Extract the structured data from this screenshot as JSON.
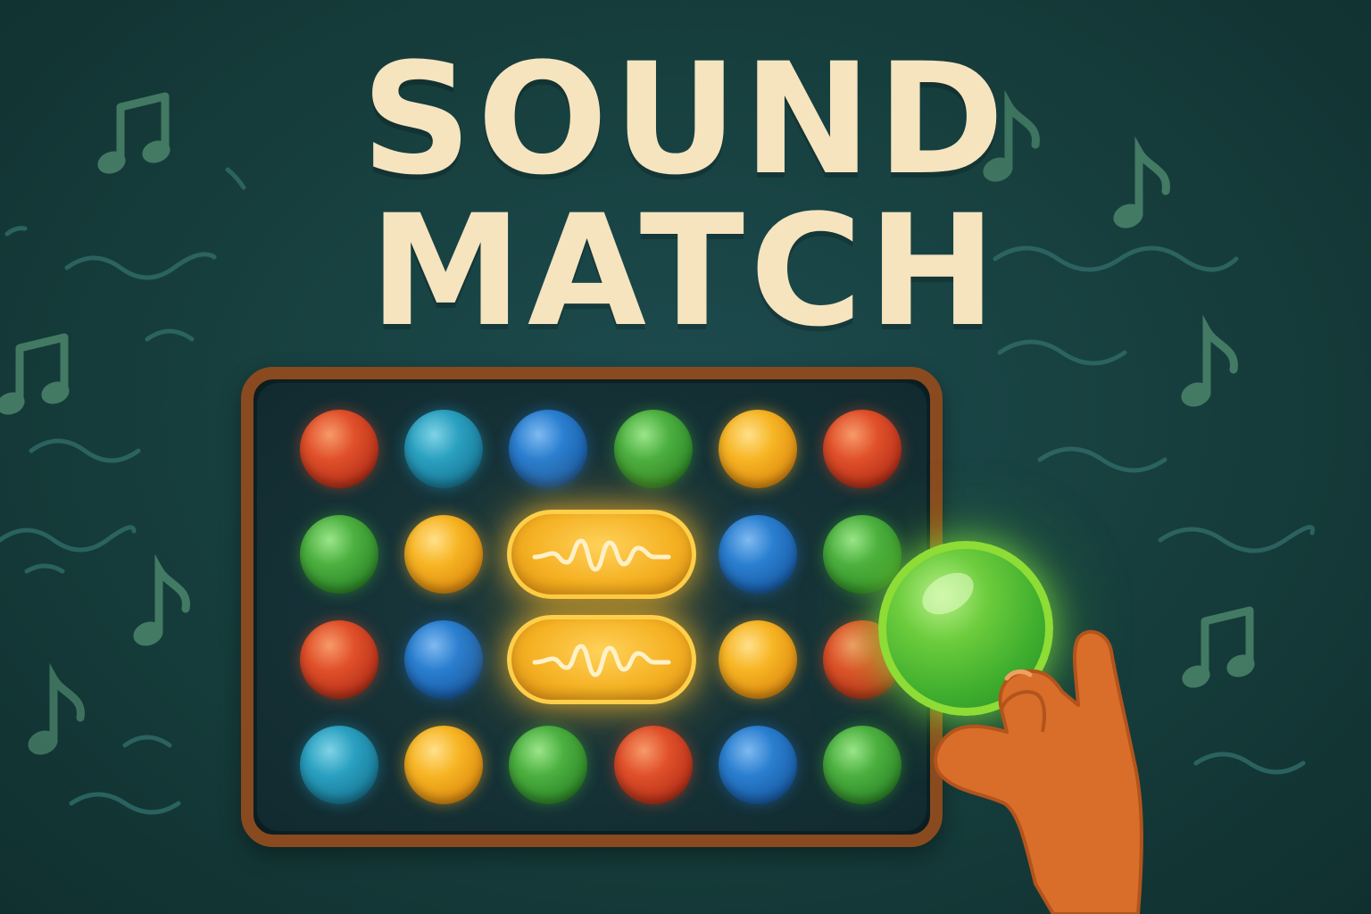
{
  "title": {
    "line1": "SOUND",
    "line2": "MATCH"
  },
  "colors": {
    "background": "#17403f",
    "title_text": "#f6e4bf",
    "board_frame": "#8a4a1f",
    "red": "#e0502a",
    "teal": "#2aa0c0",
    "blue": "#2a7fd0",
    "green": "#4cb040",
    "yellow": "#f7b524",
    "held_ball": "#6ccc3c",
    "hand": "#d86e2a"
  },
  "board": {
    "rows": [
      [
        "red",
        "teal",
        "blue",
        "green",
        "yellow",
        "red"
      ],
      [
        "green",
        "yellow",
        "wave-tile",
        "wave-tile",
        "blue",
        "green"
      ],
      [
        "red",
        "blue",
        "wave-tile",
        "wave-tile",
        "yellow",
        "red"
      ],
      [
        "teal",
        "yellow",
        "green",
        "red",
        "blue",
        "green"
      ]
    ],
    "wave_tile_icon": "sound-wave-icon"
  },
  "held_piece": {
    "color": "green",
    "icon": "hand-icon"
  },
  "decorations": {
    "icons": [
      "music-note-icon",
      "sound-wave-line-icon"
    ]
  }
}
